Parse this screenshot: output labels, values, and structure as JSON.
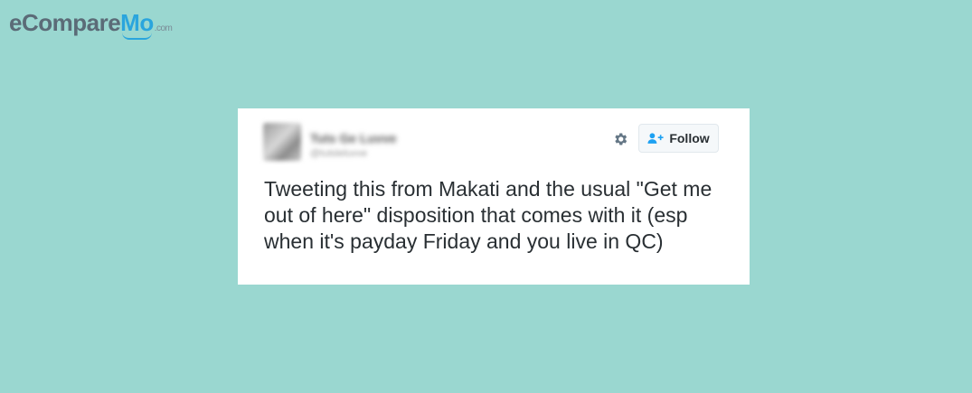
{
  "logo": {
    "part_a": "eCompare",
    "part_b": "Mo",
    "part_c": ".com"
  },
  "tweet": {
    "display_name": "Tuts Ge Luvve",
    "handle": "@tutsleluvve",
    "text": "Tweeting this from Makati and the usual \"Get me out of here\" disposition that comes with it (esp when it's payday Friday and you live in QC)",
    "avatar_icon": "user-avatar-blurred",
    "settings_icon": "gear-icon",
    "follow_label": "Follow",
    "follow_icon": "add-user-icon"
  },
  "colors": {
    "background": "#9ad7d0",
    "card": "#ffffff",
    "brand_blue": "#2aa5dd",
    "brand_gray": "#5b6b77",
    "text": "#292f33"
  }
}
